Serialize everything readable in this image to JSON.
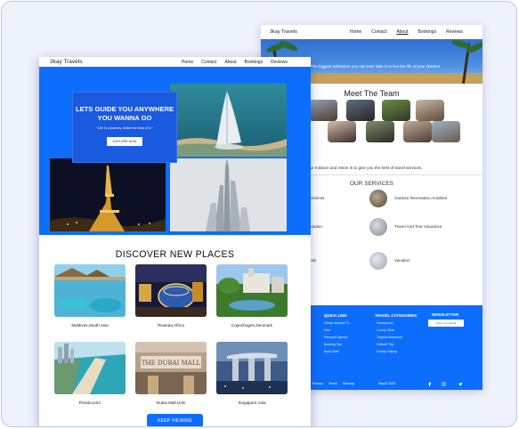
{
  "back_page": {
    "logo": "3kay Travels",
    "nav": [
      "Home",
      "Contact",
      "About",
      "Bookings",
      "Reviews"
    ],
    "hero_text": "The biggest adventure you can ever take is to live the life of your dreams.",
    "team_title": "Meet The Team",
    "mission": "Our mission and vision is to give you the best of travel services.",
    "services_title": "OUR SERVICES",
    "services": [
      {
        "label": "e Services"
      },
      {
        "label": "Outdoor Recreation Activities"
      },
      {
        "label": "modation"
      },
      {
        "label": "Travel And Tour Insurance"
      },
      {
        "label": "entals"
      },
      {
        "label": "Vacation"
      }
    ],
    "footer": {
      "quick_link_title": "QUICK LINK",
      "quick_links": [
        "Cheap Airplane Ti...",
        "Visa",
        "Passport Agency",
        "Booking Tips",
        "Book Hotel"
      ],
      "categories_title": "TRAVEL CATEGORIES",
      "categories": [
        "Honeymoon",
        "Luxury Villas",
        "Tropical Adventure",
        "Cultural Trip",
        "Family Holiday"
      ],
      "newsletter_title": "NEWSLETTER",
      "newsletter_placeholder": "Enter Your Email",
      "bottom_left": [
        "Privacy",
        "Terms",
        "Sitemap"
      ],
      "copyright": "3kay© 2022"
    }
  },
  "front_page": {
    "logo": "3kay Travels",
    "nav": [
      "Home",
      "Contact",
      "About",
      "Bookings",
      "Reviews"
    ],
    "hero_heading_1": "LETS GUIDE YOU ANYWHERE",
    "hero_heading_2": "YOU WANNA GO",
    "hero_quote": "\"Life is a journey. Make the best of it.\"",
    "hero_button": "EXPLORE NOW",
    "discover_title": "DISCOVER NEW PLACES",
    "places": [
      {
        "label": "Maldives,South Asia"
      },
      {
        "label": "Rwanda,Africa"
      },
      {
        "label": "Copenhagen,Denmark"
      },
      {
        "label": "Florida,USA"
      },
      {
        "label": "Dubai Mall,UAE"
      },
      {
        "label": "Singapore,Asia"
      }
    ],
    "keep_button": "KEEP VIEWING",
    "mall_sign": "THE DUBAI MALL"
  },
  "colors": {
    "accent": "#0d6efd",
    "frame_bg": "#eef2fd",
    "frame_border": "#b9c8ec"
  }
}
